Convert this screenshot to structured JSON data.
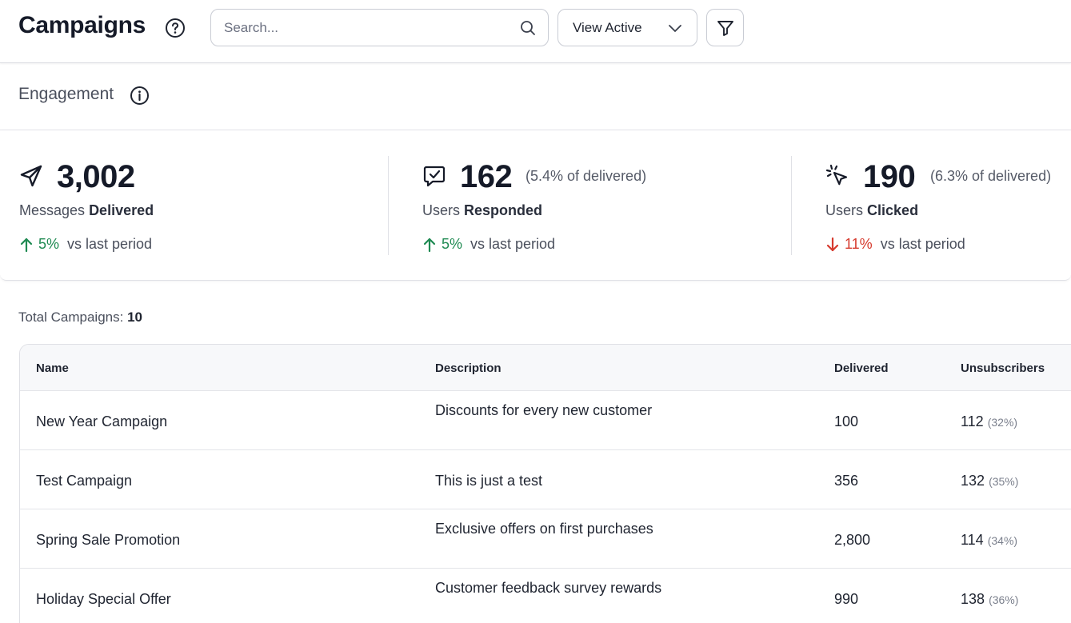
{
  "header": {
    "title": "Campaigns",
    "search_placeholder": "Search...",
    "view_label": "View Active"
  },
  "engagement": {
    "label": "Engagement",
    "stats": [
      {
        "value": "3,002",
        "pct": "",
        "label_prefix": "Messages",
        "label_bold": "Delivered",
        "trend_value": "5%",
        "trend_dir": "up",
        "trend_suffix": "vs last period"
      },
      {
        "value": "162",
        "pct": "(5.4% of delivered)",
        "label_prefix": "Users",
        "label_bold": "Responded",
        "trend_value": "5%",
        "trend_dir": "up",
        "trend_suffix": "vs last period"
      },
      {
        "value": "190",
        "pct": "(6.3% of delivered)",
        "label_prefix": "Users",
        "label_bold": "Clicked",
        "trend_value": "11%",
        "trend_dir": "down",
        "trend_suffix": "vs last period"
      }
    ]
  },
  "campaigns": {
    "total_label": "Total Campaigns:",
    "total_count": "10",
    "columns": {
      "name": "Name",
      "description": "Description",
      "delivered": "Delivered",
      "unsubscribers": "Unsubscribers"
    },
    "rows": [
      {
        "name": "New Year Campaign",
        "description": "Discounts for every new customer",
        "delivered": "100",
        "unsubscribers": "112",
        "unsub_pct": "(32%)"
      },
      {
        "name": "Test Campaign",
        "description": "This is just a test",
        "delivered": "356",
        "unsubscribers": "132",
        "unsub_pct": "(35%)"
      },
      {
        "name": "Spring Sale Promotion",
        "description": "Exclusive offers on first purchases",
        "delivered": "2,800",
        "unsubscribers": "114",
        "unsub_pct": "(34%)"
      },
      {
        "name": "Holiday Special Offer",
        "description": "Customer feedback survey rewards",
        "delivered": "990",
        "unsubscribers": "138",
        "unsub_pct": "(36%)"
      }
    ]
  },
  "colors": {
    "trend_up": "#1f8a52",
    "trend_down": "#d63a2e",
    "title": "#151a28"
  },
  "icons": {
    "stat_0": "send-icon",
    "stat_1": "message-check-icon",
    "stat_2": "cursor-click-icon"
  }
}
